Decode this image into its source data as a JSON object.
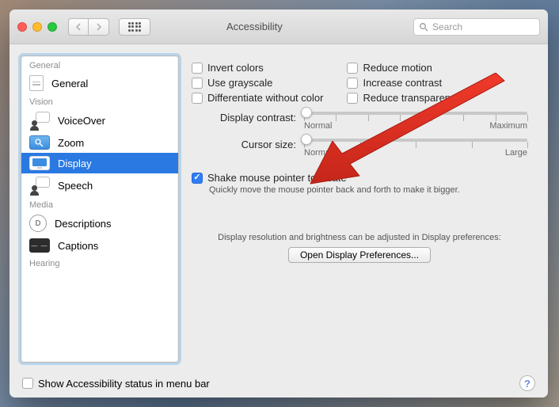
{
  "window": {
    "title": "Accessibility"
  },
  "search": {
    "placeholder": "Search"
  },
  "sidebar": {
    "sections": {
      "general": "General",
      "vision": "Vision",
      "media": "Media",
      "hearing": "Hearing"
    },
    "items": {
      "general": "General",
      "voiceover": "VoiceOver",
      "zoom": "Zoom",
      "display": "Display",
      "speech": "Speech",
      "descriptions": "Descriptions",
      "captions": "Captions"
    }
  },
  "panel": {
    "invert_colors": "Invert colors",
    "use_grayscale": "Use grayscale",
    "diff_without_color": "Differentiate without color",
    "reduce_motion": "Reduce motion",
    "increase_contrast": "Increase contrast",
    "reduce_transparency": "Reduce transparency",
    "display_contrast_label": "Display contrast:",
    "cursor_size_label": "Cursor size:",
    "slider": {
      "normal": "Normal",
      "maximum": "Maximum",
      "large": "Large"
    },
    "shake_label": "Shake mouse pointer to locate",
    "shake_hint": "Quickly move the mouse pointer back and forth to make it bigger.",
    "footer_note": "Display resolution and brightness can be adjusted in Display preferences:",
    "open_button": "Open Display Preferences..."
  },
  "bottom": {
    "status_label": "Show Accessibility status in menu bar"
  },
  "state": {
    "checks": {
      "invert_colors": false,
      "use_grayscale": false,
      "diff_without_color": false,
      "reduce_motion": false,
      "increase_contrast": false,
      "reduce_transparency": false,
      "shake": true,
      "status_bar": false
    },
    "display_contrast": 0.0,
    "cursor_size": 0.0,
    "selected_sidebar": "display"
  }
}
